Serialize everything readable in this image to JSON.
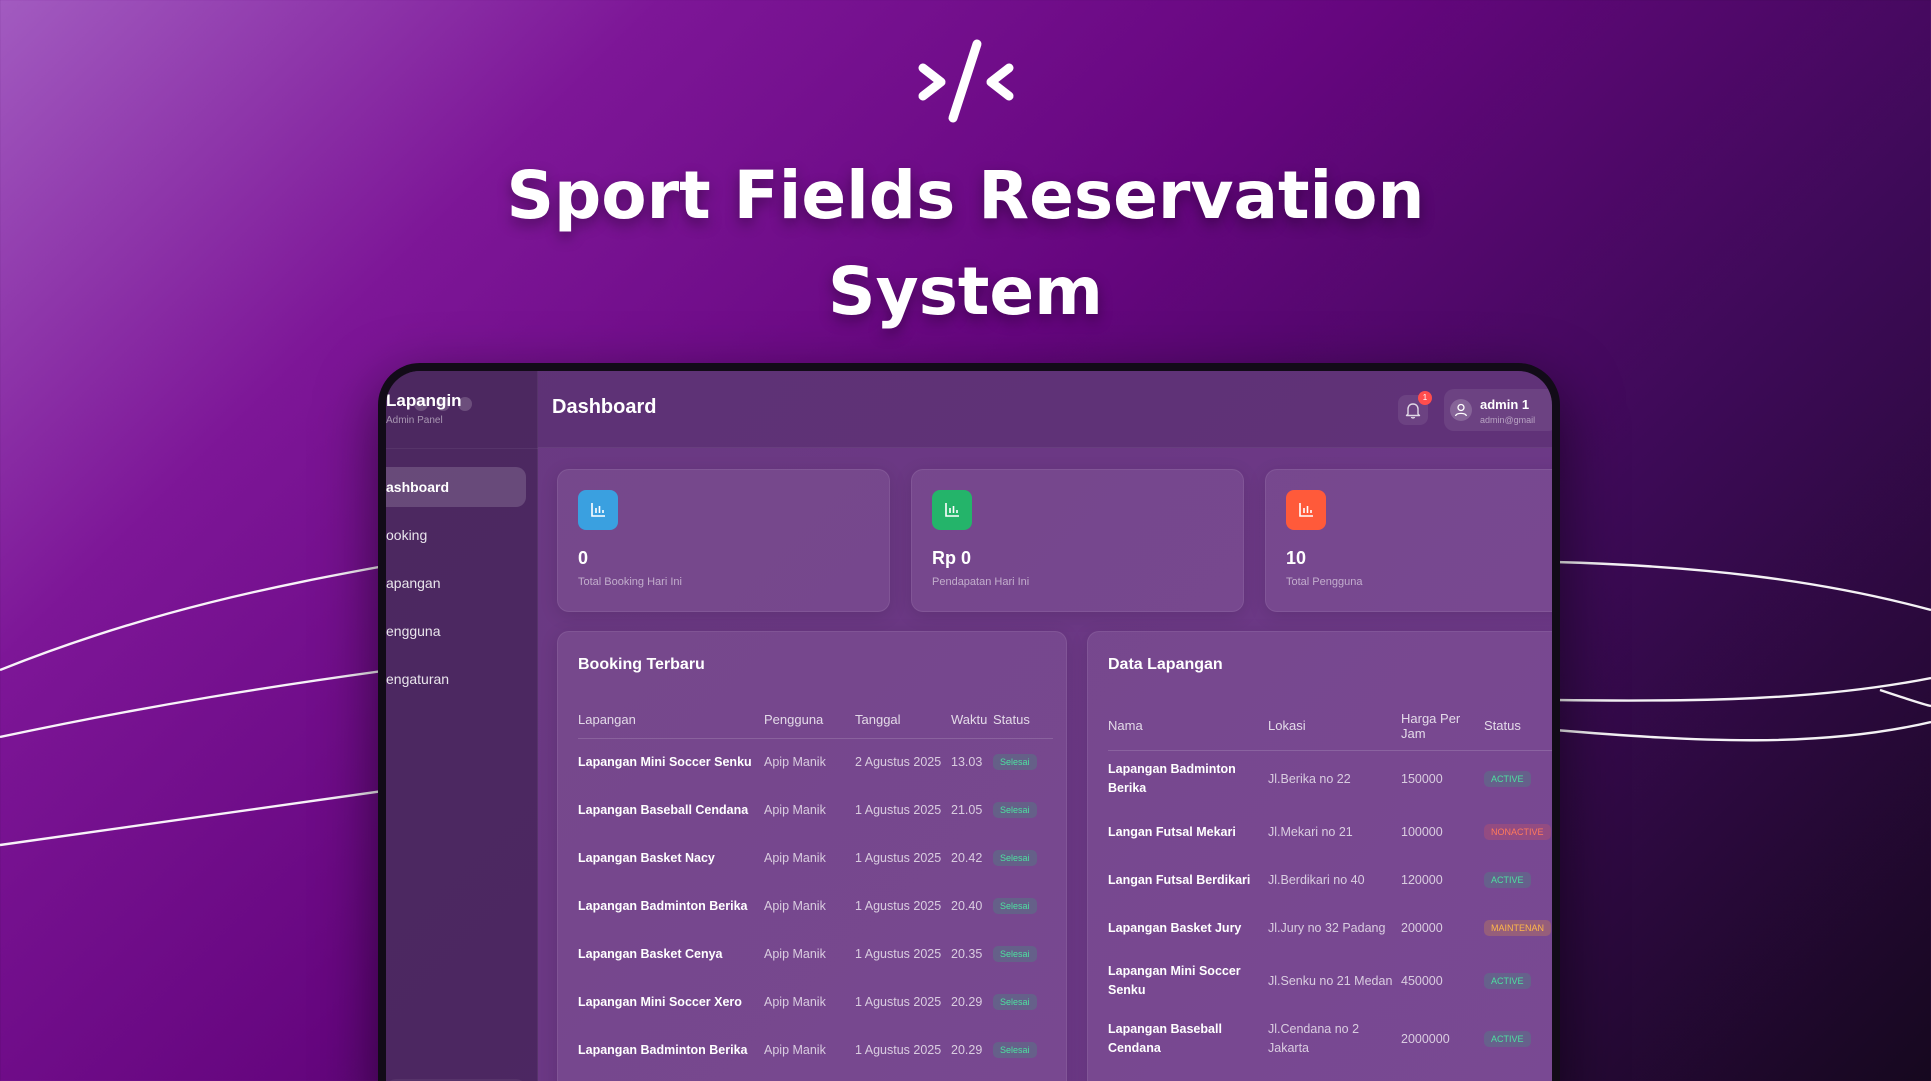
{
  "hero": {
    "title_line1": "Sport Fields Reservation",
    "title_line2": "System"
  },
  "icons": {
    "logo": "code-brackets-slash-icon",
    "stat": "bar-chart-icon",
    "bell": "bell-icon",
    "avatar": "user-icon",
    "collapse": "chevron-left-icon"
  },
  "colors": {
    "stat_blue": "#3aa0e0",
    "stat_green": "#24b46a",
    "stat_red": "#ff5a3a",
    "badge_active": "#4ee0a0",
    "badge_nonactive": "#ff7a5c",
    "badge_maintenance": "#ffb84a"
  },
  "sidebar": {
    "brand": "Lapangin",
    "brand_sub": "Admin Panel",
    "items": [
      {
        "label": "ashboard",
        "active": true
      },
      {
        "label": "ooking"
      },
      {
        "label": "apangan"
      },
      {
        "label": "engguna"
      },
      {
        "label": "engaturan"
      }
    ],
    "collapse_label": "‹"
  },
  "header": {
    "title": "Dashboard",
    "notification_count": "1",
    "user_name": "admin 1",
    "user_email": "admin@gmail"
  },
  "stats": [
    {
      "value": "0",
      "label": "Total Booking Hari Ini"
    },
    {
      "value": "Rp 0",
      "label": "Pendapatan Hari Ini"
    },
    {
      "value": "10",
      "label": "Total Pengguna"
    }
  ],
  "bookings": {
    "title": "Booking Terbaru",
    "columns": [
      "Lapangan",
      "Pengguna",
      "Tanggal",
      "Waktu",
      "Status"
    ],
    "rows": [
      [
        "Lapangan Mini Soccer Senku",
        "Apip Manik",
        "2 Agustus 2025",
        "13.03",
        "Selesai"
      ],
      [
        "Lapangan Baseball Cendana",
        "Apip Manik",
        "1 Agustus 2025",
        "21.05",
        "Selesai"
      ],
      [
        "Lapangan Basket Nacy",
        "Apip Manik",
        "1 Agustus 2025",
        "20.42",
        "Selesai"
      ],
      [
        "Lapangan Badminton Berika",
        "Apip Manik",
        "1 Agustus 2025",
        "20.40",
        "Selesai"
      ],
      [
        "Lapangan Basket Cenya",
        "Apip Manik",
        "1 Agustus 2025",
        "20.35",
        "Selesai"
      ],
      [
        "Lapangan Mini Soccer Xero",
        "Apip Manik",
        "1 Agustus 2025",
        "20.29",
        "Selesai"
      ],
      [
        "Lapangan Badminton Berika",
        "Apip Manik",
        "1 Agustus 2025",
        "20.29",
        "Selesai"
      ]
    ]
  },
  "fields": {
    "title": "Data Lapangan",
    "columns": [
      "Nama",
      "Lokasi",
      "Harga Per Jam",
      "Status"
    ],
    "rows": [
      {
        "name": "Lapangan Badminton Berika",
        "location": "Jl.Berika no 22",
        "price": "150000",
        "status": "ACTIVE",
        "tone": "green"
      },
      {
        "name": "Langan Futsal Mekari",
        "location": "Jl.Mekari no 21",
        "price": "100000",
        "status": "NONACTIVE",
        "tone": "red"
      },
      {
        "name": "Langan Futsal Berdikari",
        "location": "Jl.Berdikari no 40",
        "price": "120000",
        "status": "ACTIVE",
        "tone": "green"
      },
      {
        "name": "Lapangan Basket Jury",
        "location": "Jl.Jury no 32 Padang",
        "price": "200000",
        "status": "MAINTENAN",
        "tone": "amber"
      },
      {
        "name": "Lapangan Mini Soccer Senku",
        "location": "Jl.Senku no 21 Medan",
        "price": "450000",
        "status": "ACTIVE",
        "tone": "green"
      },
      {
        "name": "Lapangan Baseball Cendana",
        "location": "Jl.Cendana no 2 Jakarta",
        "price": "2000000",
        "status": "ACTIVE",
        "tone": "green"
      }
    ]
  }
}
